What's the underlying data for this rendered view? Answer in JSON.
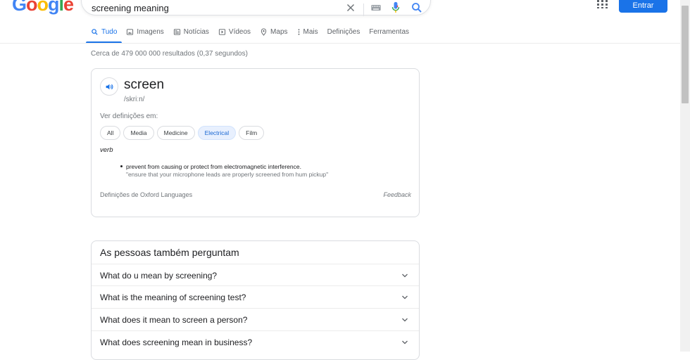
{
  "header": {
    "logo_letters": [
      "G",
      "o",
      "o",
      "g",
      "l",
      "e"
    ],
    "logo_colors": [
      "#4285f4",
      "#ea4335",
      "#fbbc05",
      "#4285f4",
      "#34a853",
      "#ea4335"
    ],
    "query": "screening meaning",
    "signin_label": "Entrar",
    "icons": [
      "clear-icon",
      "keyboard-icon",
      "mic-icon",
      "search-icon",
      "apps-icon"
    ]
  },
  "tabs": [
    {
      "label": "Tudo",
      "icon": "search-icon",
      "active": true
    },
    {
      "label": "Imagens",
      "icon": "image-icon"
    },
    {
      "label": "Notícias",
      "icon": "news-icon"
    },
    {
      "label": "Vídeos",
      "icon": "video-icon"
    },
    {
      "label": "Maps",
      "icon": "map-pin-icon"
    },
    {
      "label": "Mais",
      "icon": "more-vert-icon"
    },
    {
      "label": "Definições"
    },
    {
      "label": "Ferramentas"
    }
  ],
  "results_count": "Cerca de 479 000 000 resultados (0,37 segundos)",
  "dictionary": {
    "word": "screen",
    "phonetic": "/skriːn/",
    "see_definitions": "Ver definições em:",
    "chips": [
      "All",
      "Media",
      "Medicine",
      "Electrical",
      "Film"
    ],
    "selected_chip": "Electrical",
    "part_of_speech": "verb",
    "definition": "prevent from causing or protect from electromagnetic interference.",
    "example": "\"ensure that your microphone leads are properly screened from hum pickup\"",
    "source": "Definições de Oxford Languages",
    "feedback": "Feedback"
  },
  "people_also_ask": {
    "title": "As pessoas também perguntam",
    "questions": [
      "What do u mean by screening?",
      "What is the meaning of screening test?",
      "What does it mean to screen a person?",
      "What does screening mean in business?"
    ]
  },
  "colors": {
    "accent": "#1a73e8",
    "chip_selected_bg": "#e8f0fe"
  }
}
